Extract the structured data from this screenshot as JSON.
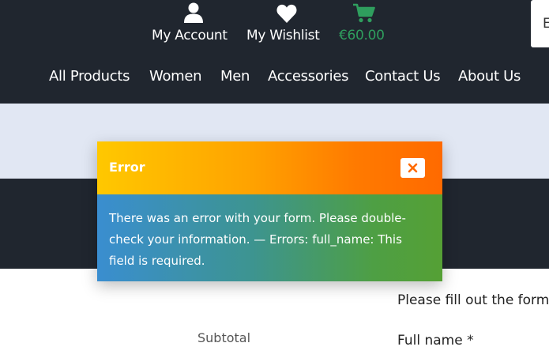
{
  "header": {
    "account": {
      "label": "My Account",
      "icon": "user-icon"
    },
    "wishlist": {
      "label": "My Wishlist",
      "icon": "heart-icon"
    },
    "cart": {
      "total": "€60.00",
      "icon": "cart-icon",
      "color": "#2f9e5e"
    },
    "side_widget_text": "E"
  },
  "nav": {
    "items": [
      "All Products",
      "Women",
      "Men",
      "Accessories",
      "Contact Us",
      "About Us"
    ]
  },
  "page": {
    "form_intro": "Please fill out the form",
    "full_name_label": "Full name *",
    "subtotal_label": "Subtotal"
  },
  "modal": {
    "title": "Error",
    "close_icon": "close-icon",
    "message": "There was an error with your form. Please double-check your information. — Errors: full_name: This field is required."
  },
  "colors": {
    "header_bg": "#20262f",
    "light_band": "#e1e7f3",
    "accent_green": "#2f9e5e",
    "modal_head_start": "#ffc800",
    "modal_head_end": "#ff6a00",
    "modal_body_start": "#3a8ed0",
    "modal_body_end": "#55a035"
  }
}
